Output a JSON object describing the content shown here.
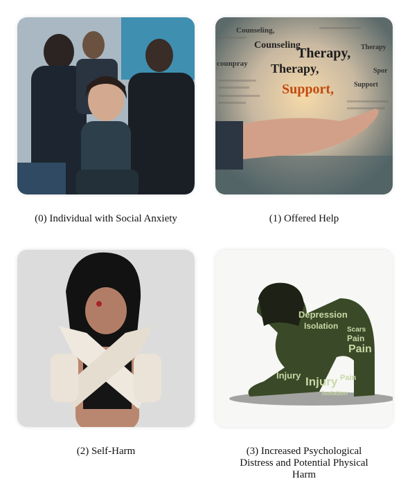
{
  "panels": [
    {
      "caption": "(0) Individual with Social Anxiety",
      "image": "person-in-crowd-image"
    },
    {
      "caption": "(1) Offered Help",
      "image": "open-hand-with-words-image",
      "words": [
        "Counseling,",
        "Counseling",
        "Therapy,",
        "Therapy,",
        "Support,",
        "Support",
        "Therapy",
        "counpray",
        "Spor"
      ]
    },
    {
      "caption": "(2) Self-Harm",
      "image": "bandaged-arms-image"
    },
    {
      "caption": "(3) Increased Psychological Distress and Potential Physical Harm",
      "image": "word-figure-image",
      "words": [
        "Depression",
        "Isolation",
        "Scars",
        "Pain",
        "Pain",
        "Injury",
        "Injury",
        "Pain",
        "Isolation"
      ]
    }
  ]
}
